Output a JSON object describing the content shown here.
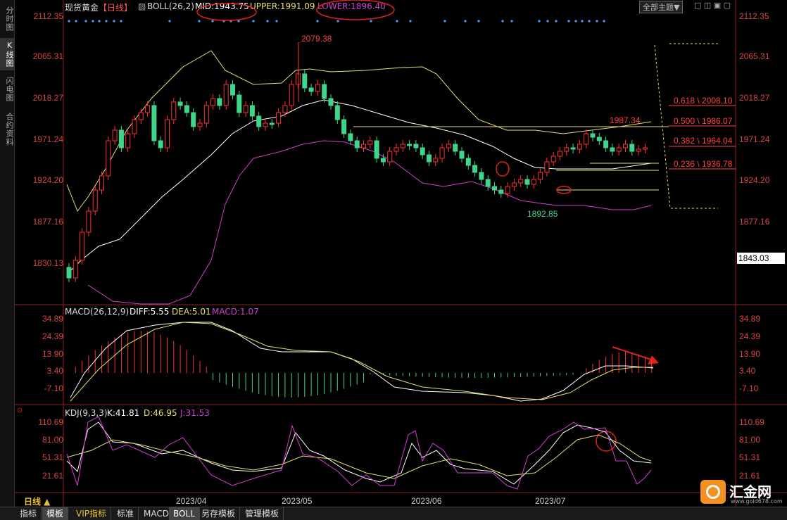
{
  "left_tabs": [
    "分时图",
    "K线图",
    "闪电图",
    "合约资料"
  ],
  "header": {
    "symbol": "现货黄金",
    "period": "【日线】",
    "boll_label": "BOLL(26,2)",
    "mid": "MID:1943.75",
    "upper": "UPPER:1991.09",
    "lower": "LOWER:1896.40",
    "theme_select": "全部主题▼"
  },
  "price_axis": [
    "2112.35",
    "2065.31",
    "2018.27",
    "1971.24",
    "1924.20",
    "1877.16",
    "1830.13"
  ],
  "current_price_tag": "1843.03",
  "annotations": {
    "high": "2079.38",
    "low": "1892.85",
    "recent_high": "1987.34",
    "fib": [
      "0.618 \\ 2008.10",
      "0.500 \\ 1986.07",
      "0.382 \\ 1964.04",
      "0.236 \\ 1936.78"
    ]
  },
  "macd": {
    "label": "MACD(26,12,9)",
    "diff": "DIFF:5.55",
    "dea": "DEA:5.01",
    "macd": "MACD:1.07",
    "axis": [
      "34.89",
      "24.39",
      "13.90",
      "3.40",
      "-7.10"
    ]
  },
  "kdj": {
    "label": "KDJ(9,3,3)",
    "k": "K:41.81",
    "d": "D:46.95",
    "j": "J:31.53",
    "axis": [
      "110.69",
      "81.00",
      "51.31",
      "21.61"
    ]
  },
  "dates": [
    "2023/04",
    "2023/05",
    "2023/06",
    "2023/07"
  ],
  "period_button": "日线 ▲",
  "bottom_tabs": [
    "指标",
    "模板",
    "VIP指标",
    "标准",
    "MACD",
    "BOLL",
    "另存模板",
    "管理模板"
  ],
  "logo": {
    "name": "汇金网",
    "url": "www.gold678.com"
  },
  "colors": {
    "up": "#ff3030",
    "down": "#3fd58a",
    "mid": "#ffffff",
    "upper": "#e8e070",
    "lower": "#d040d0"
  }
}
